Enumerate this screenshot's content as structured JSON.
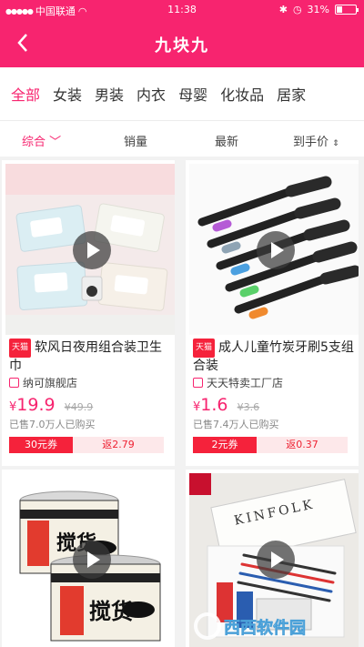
{
  "status_bar": {
    "carrier": "中国联通",
    "time": "11:38",
    "battery": "31%",
    "battery_level": 0.31
  },
  "header": {
    "title": "九块九"
  },
  "categories": [
    "全部",
    "女装",
    "男装",
    "内衣",
    "母婴",
    "化妆品",
    "居家"
  ],
  "sort": {
    "items": [
      "综合",
      "销量",
      "最新",
      "到手价"
    ]
  },
  "products": [
    {
      "badge": "天猫",
      "title": "软风日夜用组合装卫生巾",
      "shop": "纳可旗舰店",
      "currency": "¥",
      "price": "19.9",
      "orig": "¥49.9",
      "sold": "已售7.0万人已购买",
      "coupon": "30元券",
      "rebate_label": "返",
      "rebate": "2.79"
    },
    {
      "badge": "天猫",
      "title": "成人儿童竹炭牙刷5支组合装",
      "shop": "天天特卖工厂店",
      "currency": "¥",
      "price": "1.6",
      "orig": "¥3.6",
      "sold": "已售7.4万人已购买",
      "coupon": "2元券",
      "rebate_label": "返",
      "rebate": "0.37"
    },
    {
      "label": "搅货"
    },
    {
      "label": "KINFOLK"
    }
  ],
  "watermark": {
    "text": "西西软件园"
  },
  "colors": {
    "accent": "#f7246f",
    "coupon": "#f5223b",
    "rebate_bg": "#fde8ea"
  }
}
